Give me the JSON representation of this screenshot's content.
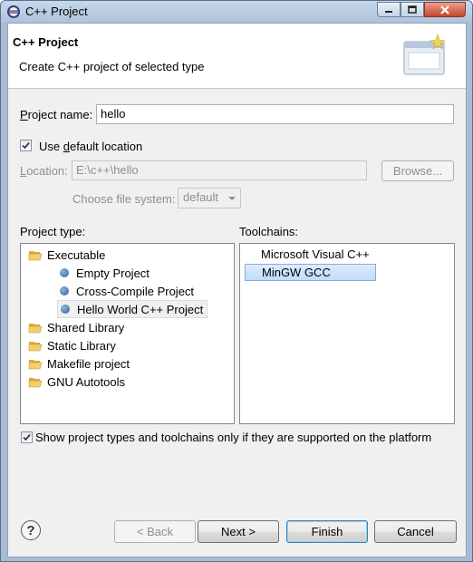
{
  "window": {
    "title": "C++ Project",
    "controls": {
      "minimize": "minimize",
      "maximize": "maximize",
      "close": "close"
    }
  },
  "header": {
    "title": "C++ Project",
    "description": "Create C++ project of selected type",
    "image_icon": "new-project-wizard-icon"
  },
  "project_name": {
    "label_pre": "",
    "label_u": "P",
    "label_post": "roject name:",
    "value": "hello"
  },
  "default_location": {
    "checked": true,
    "label_pre": "Use ",
    "label_u": "d",
    "label_post": "efault location"
  },
  "location": {
    "label_pre": "",
    "label_u": "L",
    "label_post": "ocation:",
    "value": "E:\\c++\\hello",
    "browse_label": "Browse..."
  },
  "file_system": {
    "label": "Choose file system:",
    "selected": "default"
  },
  "project_type": {
    "label": "Project type:",
    "items": [
      {
        "label": "Executable",
        "icon": "folder-icon"
      },
      {
        "label": "Empty Project",
        "icon": "bullet-icon"
      },
      {
        "label": "Cross-Compile Project",
        "icon": "bullet-icon"
      },
      {
        "label": "Hello World C++ Project",
        "icon": "bullet-icon",
        "selected": true
      },
      {
        "label": "Shared Library",
        "icon": "folder-icon"
      },
      {
        "label": "Static Library",
        "icon": "folder-icon"
      },
      {
        "label": "Makefile project",
        "icon": "folder-icon"
      },
      {
        "label": "GNU Autotools",
        "icon": "folder-icon"
      }
    ]
  },
  "toolchains": {
    "label": "Toolchains:",
    "items": [
      {
        "label": "Microsoft Visual C++"
      },
      {
        "label": "MinGW GCC",
        "selected": true
      }
    ]
  },
  "filter": {
    "checked": true,
    "label": "Show project types and toolchains only if they are supported on the platform"
  },
  "buttons": {
    "help_glyph": "?",
    "back": "< Back",
    "next": "Next >",
    "finish": "Finish",
    "cancel": "Cancel"
  },
  "colors": {
    "selection": "#c1dcfc",
    "bullet": "#2e5f9a",
    "folder": "#e8c063"
  }
}
